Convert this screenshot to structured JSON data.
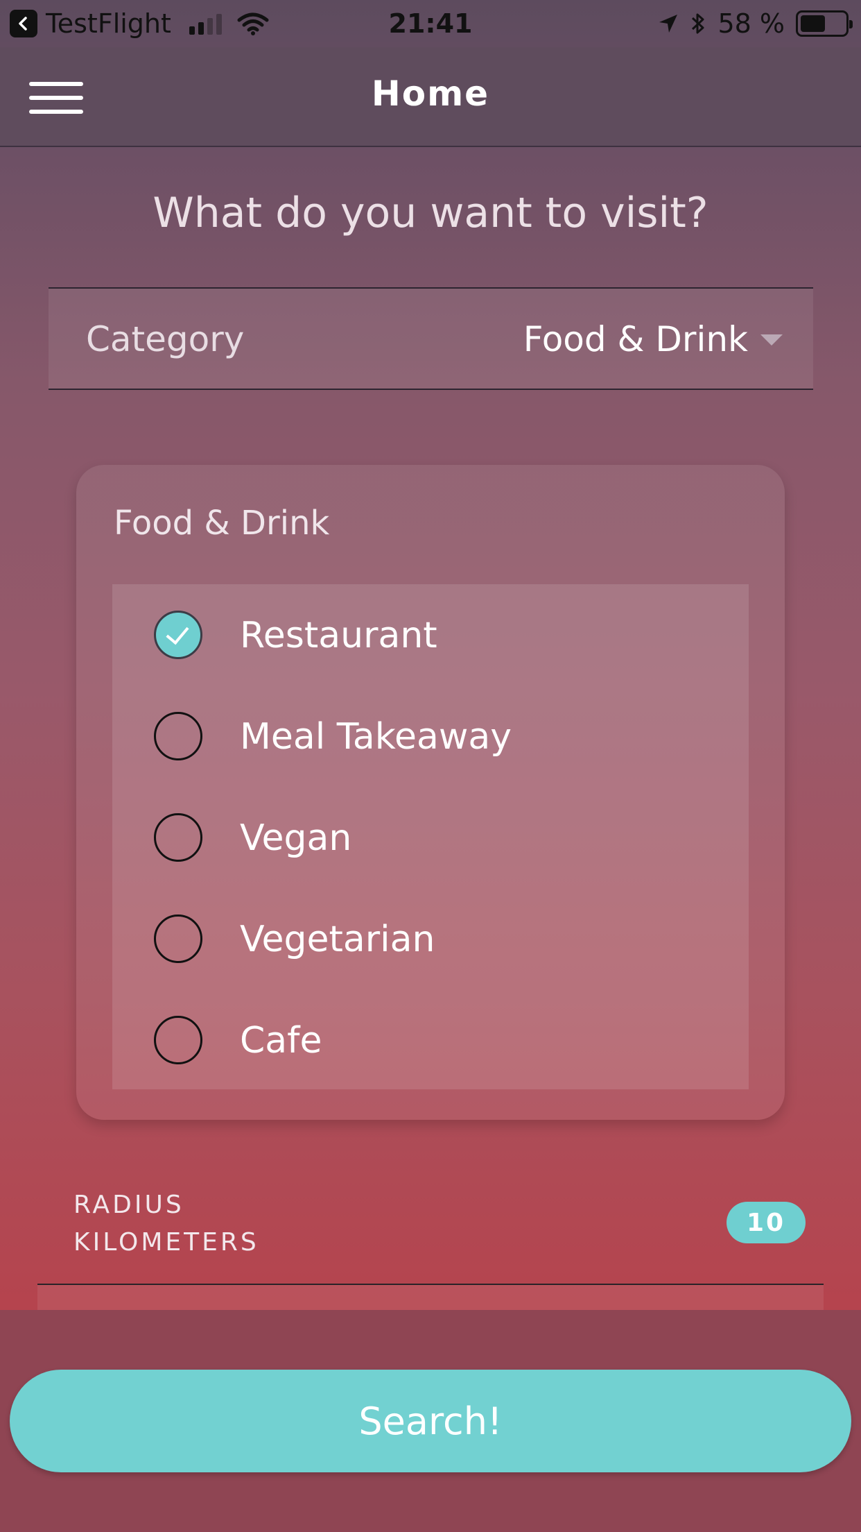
{
  "status_bar": {
    "back_app": "TestFlight",
    "time": "21:41",
    "battery": "58 %"
  },
  "nav": {
    "title": "Home"
  },
  "prompt": "What do you want to visit?",
  "category": {
    "label": "Category",
    "value": "Food & Drink"
  },
  "options_card": {
    "title": "Food & Drink",
    "options": [
      {
        "label": "Restaurant",
        "checked": true
      },
      {
        "label": "Meal Takeaway",
        "checked": false
      },
      {
        "label": "Vegan",
        "checked": false
      },
      {
        "label": "Vegetarian",
        "checked": false
      },
      {
        "label": "Cafe",
        "checked": false
      }
    ]
  },
  "radius": {
    "label_line1": "RADIUS",
    "label_line2": "KILOMETERS",
    "value": "10"
  },
  "search_button": "Search!",
  "colors": {
    "accent": "#6fcfd0",
    "bottom_bar": "#8f4553",
    "nav_bar": "#5f4c5d"
  }
}
